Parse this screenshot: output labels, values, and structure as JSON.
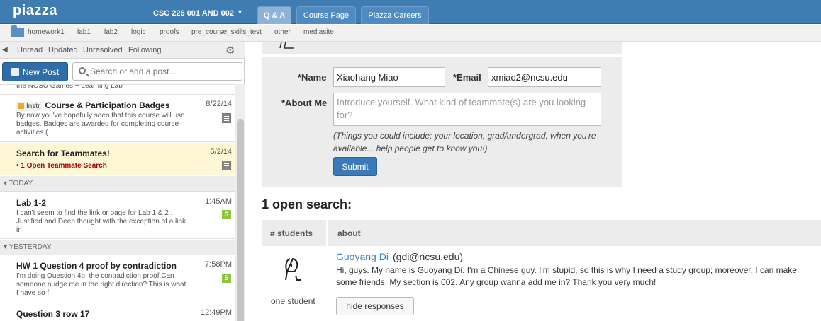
{
  "app": {
    "logo": "piazza",
    "course": "CSC 226 001 AND 002"
  },
  "tabs": [
    {
      "label": "Q & A"
    },
    {
      "label": "Course Page"
    },
    {
      "label": "Piazza Careers"
    }
  ],
  "folders": [
    "homework1",
    "lab1",
    "lab2",
    "logic",
    "proofs",
    "pre_course_skills_test",
    "other",
    "mediasite"
  ],
  "filters": [
    "Unread",
    "Updated",
    "Unresolved",
    "Following"
  ],
  "new_post_label": "New Post",
  "search_placeholder": "Search or add a post...",
  "feed": {
    "partial_top": "the NCSU Games + Learning Lab",
    "posts": [
      {
        "badge": "Instr",
        "title": "Course & Participation Badges",
        "date": "8/22/14",
        "snippet": "By now you've hopefully seen that this course will use badges. Badges are awarded for completing course activities ("
      },
      {
        "title": "Search for Teammates!",
        "date": "5/2/14",
        "sub": "1 Open Teammate Search"
      }
    ],
    "sections": [
      {
        "label": "TODAY",
        "posts": [
          {
            "title": "Lab 1-2",
            "date": "1:45AM",
            "snippet": "I can't seem to find the link or page for Lab 1 & 2 : Justified and Deep thought with the exception of a link in",
            "status": "S"
          }
        ]
      },
      {
        "label": "YESTERDAY",
        "posts": [
          {
            "title": "HW 1 Question 4 proof by contradiction",
            "date": "7:58PM",
            "snippet": "I'm doing Question 4b, the contradiction proof.Can someone nudge me in the right direction? This is what I have so f",
            "status": "S"
          },
          {
            "title": "Question 3 row 17",
            "date": "12:49PM"
          }
        ]
      }
    ]
  },
  "form": {
    "name_label": "*Name",
    "name_value": "Xiaohang Miao",
    "email_label": "*Email",
    "email_value": "xmiao2@ncsu.edu",
    "about_label": "*About Me",
    "about_placeholder": "Introduce yourself. What kind of teammate(s) are you looking for?",
    "hint": "(Things you could include: your location, grad/undergrad, when you're available... help people get to know you!)",
    "submit": "Submit"
  },
  "search_results": {
    "heading": "1 open search:",
    "col_students": "# students",
    "col_about": "about",
    "count_label": "one student",
    "name": "Guoyang Di",
    "email": "(gdi@ncsu.edu)",
    "about": "Hi, guys. My name is Guoyang Di. I'm a Chinese guy. I'm stupid, so this is why I need a study group; moreover, I can make some friends. My section is 002. Any group wanna add me in? Thank you very much!",
    "hide_button": "hide responses"
  }
}
